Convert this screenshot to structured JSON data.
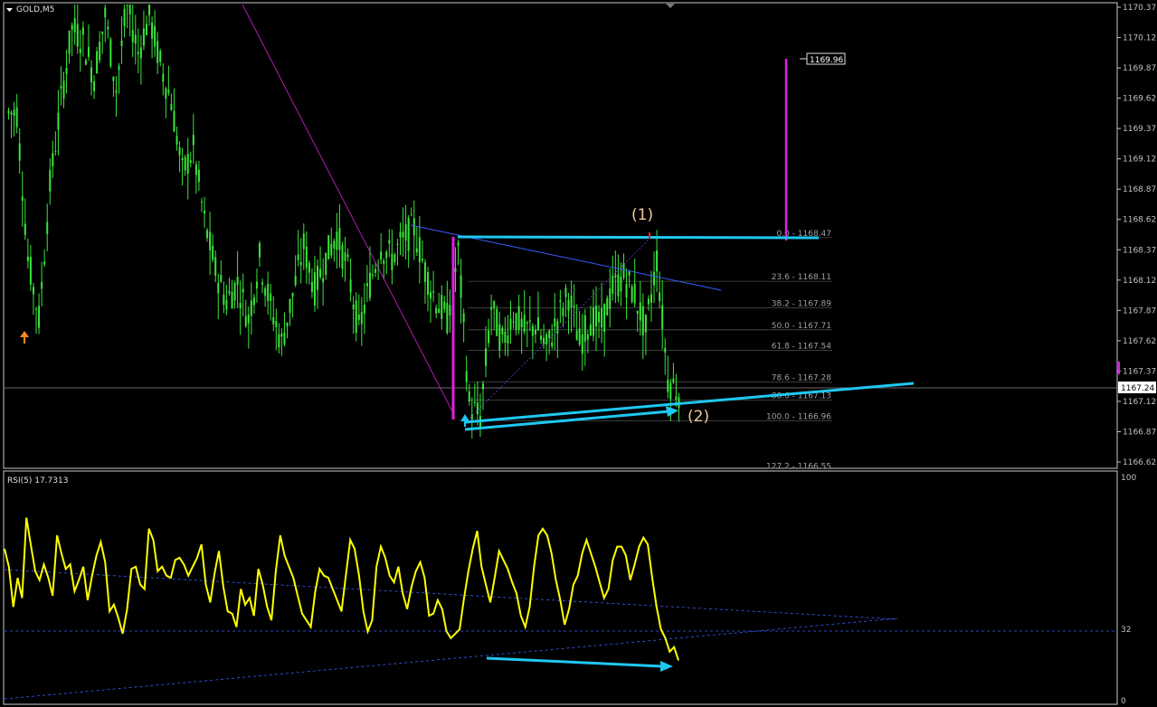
{
  "colors": {
    "background": "#000000",
    "grid_border": "#c8c8c8",
    "candle": "#39e639",
    "channel": "#1ec8f0",
    "magenta": "#e020e0",
    "trendline": "#3a5cff",
    "rsi_line": "#ffff00",
    "rsi_dotted": "#3a5cff",
    "annotation": "#f3c89a",
    "fib_line": "#5a6060",
    "price_label_bg": "#ffffff"
  },
  "main_chart": {
    "symbol_label": "GOLD,M5",
    "price_ticks": [
      "1170.37",
      "1170.12",
      "1169.87",
      "1169.62",
      "1169.37",
      "1169.12",
      "1168.87",
      "1168.62",
      "1168.37",
      "1168.12",
      "1167.87",
      "1167.62",
      "1167.37",
      "1167.12",
      "1166.87",
      "1166.62"
    ],
    "current_price": "1167.24",
    "callout_price": "1169.96",
    "annotation_1": "(1)",
    "annotation_2": "(2)",
    "fib_levels": [
      {
        "label": "0.0 - 1168.47",
        "price": 1168.47
      },
      {
        "label": "23.6 - 1168.11",
        "price": 1168.11
      },
      {
        "label": "38.2 - 1167.89",
        "price": 1167.89
      },
      {
        "label": "50.0 - 1167.71",
        "price": 1167.71
      },
      {
        "label": "61.8 - 1167.54",
        "price": 1167.54
      },
      {
        "label": "78.6 - 1167.28",
        "price": 1167.28
      },
      {
        "label": "88.6 - 1167.13",
        "price": 1167.13
      },
      {
        "label": "100.0 - 1166.96",
        "price": 1166.96
      },
      {
        "label": "127.2 - 1166.55",
        "price": 1166.55
      }
    ]
  },
  "rsi_panel": {
    "label": "RSI(5) 17.7313",
    "ticks": [
      "100",
      "32",
      "0"
    ]
  },
  "chart_data": [
    {
      "type": "candlestick",
      "title": "GOLD,M5",
      "ylim": [
        1166.55,
        1170.4
      ],
      "close_series": [
        1169.5,
        1168.3,
        1167.8,
        1168.9,
        1169.6,
        1170.2,
        1170.1,
        1169.8,
        1170.3,
        1169.7,
        1170.4,
        1170.0,
        1170.3,
        1169.9,
        1169.6,
        1169.0,
        1169.2,
        1168.6,
        1168.2,
        1167.95,
        1168.1,
        1167.8,
        1168.3,
        1167.9,
        1167.6,
        1168.0,
        1168.4,
        1168.05,
        1168.3,
        1168.5,
        1168.2,
        1167.7,
        1168.1,
        1168.4,
        1168.3,
        1168.45,
        1168.55,
        1168.2,
        1167.95,
        1167.8,
        1168.35,
        1167.1,
        1166.98,
        1167.9,
        1167.6,
        1167.85,
        1167.7,
        1167.75,
        1167.55,
        1167.8,
        1168.0,
        1167.6,
        1167.8,
        1167.75,
        1168.05,
        1168.15,
        1168.0,
        1167.7,
        1168.3,
        1167.3,
        1167.2
      ],
      "current_price": 1167.24,
      "annotated_high": 1169.96
    },
    {
      "type": "line",
      "title": "RSI(5) 17.7313",
      "ylim": [
        0,
        100
      ],
      "levels": [
        32
      ],
      "values": [
        68,
        60,
        42,
        55,
        46,
        82,
        70,
        58,
        54,
        61,
        55,
        47,
        74,
        66,
        59,
        61,
        49,
        54,
        60,
        45,
        56,
        65,
        71,
        62,
        40,
        43,
        37,
        30,
        41,
        59,
        60,
        52,
        50,
        77,
        72,
        58,
        60,
        56,
        55,
        63,
        64,
        61,
        56,
        60,
        64,
        70,
        52,
        44,
        57,
        67,
        51,
        40,
        39,
        33,
        50,
        43,
        46,
        38,
        59,
        52,
        42,
        36,
        58,
        74,
        65,
        60,
        55,
        47,
        39,
        36,
        33,
        49,
        59,
        56,
        55,
        50,
        45,
        40,
        56,
        72,
        68,
        56,
        40,
        31,
        36,
        60,
        69,
        64,
        56,
        53,
        60,
        48,
        41,
        51,
        58,
        62,
        55,
        38,
        39,
        45,
        41,
        31,
        28,
        30,
        32,
        46,
        58,
        68,
        76,
        60,
        52,
        44,
        55,
        67,
        63,
        59,
        53,
        48,
        38,
        33,
        42,
        60,
        74,
        77,
        74,
        66,
        54,
        45,
        34,
        41,
        52,
        56,
        66,
        72,
        66,
        60,
        53,
        46,
        50,
        63,
        69,
        69,
        65,
        54,
        61,
        69,
        73,
        70,
        55,
        42,
        32,
        28,
        22,
        24,
        18
      ]
    }
  ]
}
